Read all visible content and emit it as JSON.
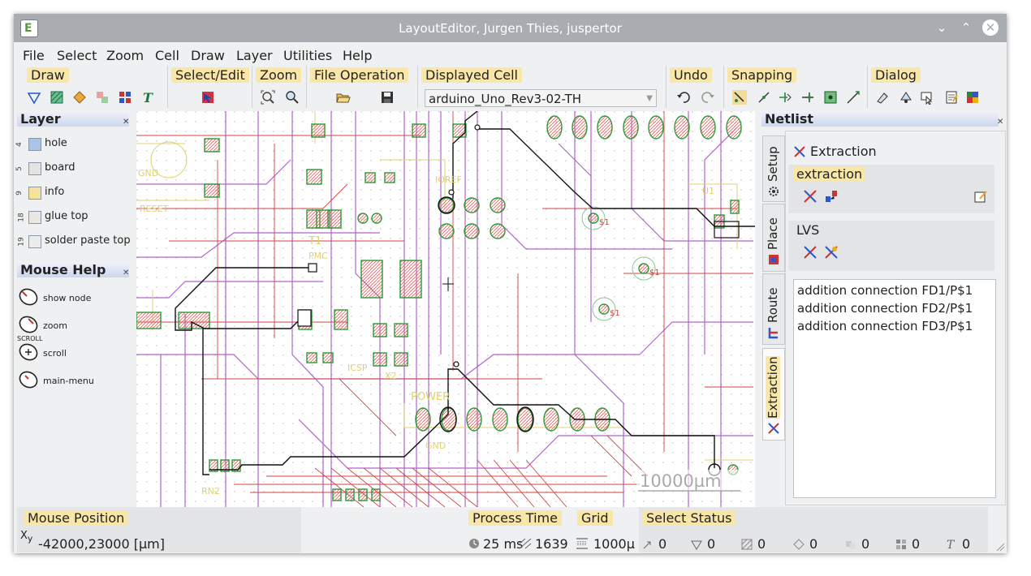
{
  "window": {
    "title": "LayoutEditor, Jurgen Thies, juspertor",
    "logo_letter": "E"
  },
  "menu": [
    "File",
    "Select",
    "Zoom",
    "Cell",
    "Draw",
    "Layer",
    "Utilities",
    "Help"
  ],
  "toolbars": {
    "draw": "Draw",
    "select_edit": "Select/Edit",
    "zoom": "Zoom",
    "file_operation": "File Operation",
    "displayed_cell": "Displayed Cell",
    "displayed_cell_value": "arduino_Uno_Rev3-02-TH",
    "undo": "Undo",
    "snapping": "Snapping",
    "dialog": "Dialog"
  },
  "layer_panel": {
    "title": "Layer",
    "items": [
      {
        "num": "4",
        "name": "hole",
        "color": "#aac4e8"
      },
      {
        "num": "5",
        "name": "board",
        "color": "#e4e4e4"
      },
      {
        "num": "9",
        "name": "info",
        "color": "#f5e39a"
      },
      {
        "num": "18",
        "name": "glue top",
        "color": "#e8e8e0"
      },
      {
        "num": "19",
        "name": "solder paste top",
        "color": "#ececec"
      }
    ]
  },
  "mouse_help": {
    "title": "Mouse Help",
    "scroll_caption": "SCROLL",
    "items": [
      "show node",
      "zoom",
      "scroll",
      "main-menu"
    ]
  },
  "canvas": {
    "scale_label": "10000µm",
    "labels": [
      "GND",
      "RESET",
      "T1",
      "PMC",
      "POWER",
      "GND",
      "RN2",
      "$1",
      "$1",
      "$1",
      "IOREF",
      "ICSP",
      "U1",
      "X2"
    ]
  },
  "netlist": {
    "title": "Netlist",
    "tabs": [
      "Setup",
      "Place",
      "Route",
      "Extraction"
    ],
    "active_tab": "Extraction",
    "header": "Extraction",
    "section_extraction": "extraction",
    "section_lvs": "LVS",
    "messages": [
      "addition connection FD1/P$1",
      "addition connection FD2/P$1",
      "addition connection FD3/P$1"
    ]
  },
  "status": {
    "mouse_position_title": "Mouse Position",
    "mouse_position_value": "-42000,23000 [µm]",
    "process_time_title": "Process Time",
    "process_time_value": "25 ms",
    "process_count": "1639",
    "grid_title": "Grid",
    "grid_value": "1000µ",
    "select_status_title": "Select Status",
    "select_counts": [
      "0",
      "0",
      "0",
      "0",
      "0",
      "0",
      "0"
    ]
  }
}
